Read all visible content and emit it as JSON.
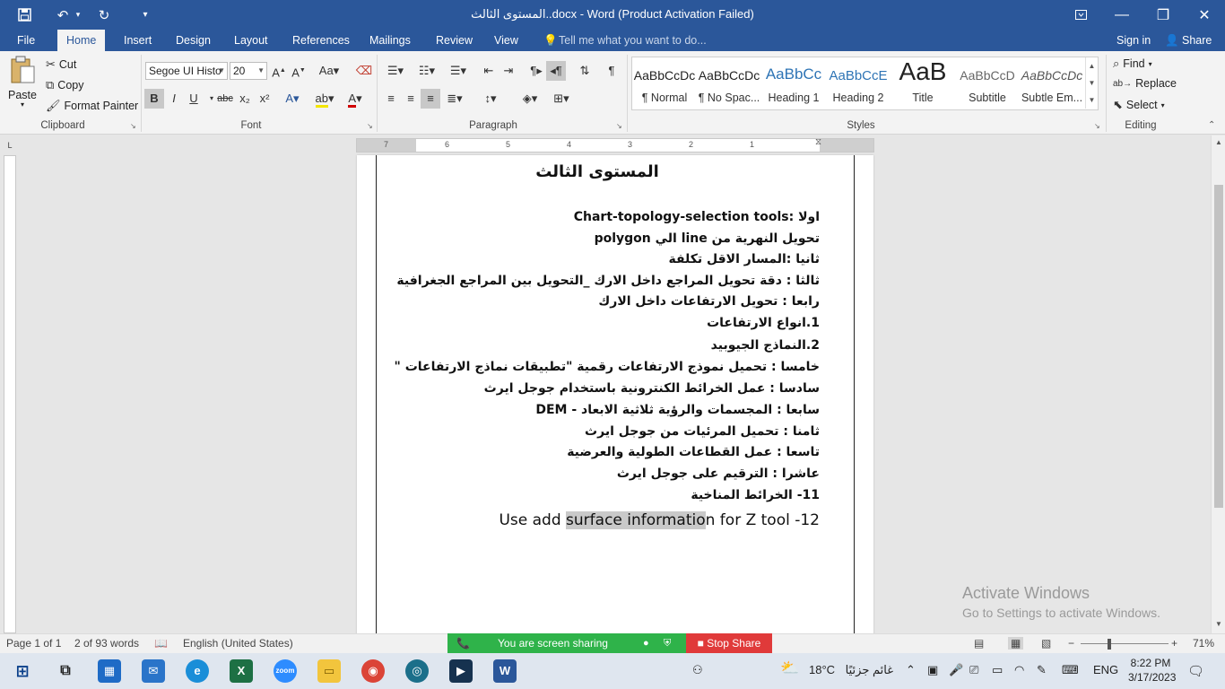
{
  "window": {
    "title": "المستوى الثالث..docx - Word (Product Activation Failed)",
    "quick_access": {
      "save": "save-icon",
      "undo": "undo-icon",
      "redo": "redo-icon",
      "customize": "▾"
    },
    "controls": {
      "ribbon_display": "ribbon-display-icon",
      "minimize": "—",
      "restore": "❐",
      "close": "✕"
    }
  },
  "tabs": [
    "File",
    "Home",
    "Insert",
    "Design",
    "Layout",
    "References",
    "Mailings",
    "Review",
    "View"
  ],
  "active_tab": "Home",
  "tell_me": "Tell me what you want to do...",
  "signin": "Sign in",
  "share": "Share",
  "clipboard": {
    "paste": "Paste",
    "cut": "Cut",
    "copy": "Copy",
    "format_painter": "Format Painter",
    "label": "Clipboard"
  },
  "font": {
    "name": "Segoe UI Histo",
    "size": "20",
    "label": "Font",
    "bold": "B",
    "italic": "I",
    "underline": "U",
    "strike": "abc",
    "subscript": "x₂",
    "superscript": "x²"
  },
  "paragraph": {
    "label": "Paragraph"
  },
  "styles": {
    "label": "Styles",
    "items": [
      {
        "preview": "AaBbCcDc",
        "label": "¶ Normal"
      },
      {
        "preview": "AaBbCcDc",
        "label": "¶ No Spac..."
      },
      {
        "preview": "AaBbCc",
        "label": "Heading 1"
      },
      {
        "preview": "AaBbCcE",
        "label": "Heading 2"
      },
      {
        "preview": "AaB",
        "label": "Title"
      },
      {
        "preview": "AaBbCcD",
        "label": "Subtitle"
      },
      {
        "preview": "AaBbCcDc",
        "label": "Subtle Em..."
      }
    ]
  },
  "editing": {
    "find": "Find",
    "replace": "Replace",
    "select": "Select",
    "label": "Editing"
  },
  "ruler": {
    "numbers": [
      "7",
      "6",
      "5",
      "4",
      "3",
      "2",
      "1"
    ]
  },
  "document": {
    "heading": "المستوى الثالث",
    "lines": [
      "اولا :Chart-topology-selection tools",
      "تحويل النهرية من  line الي  polygon",
      "ثانيا :المسار الاقل تكلفة",
      "ثالثا : دقة تحويل المراجع داخل الارك _التحويل بين المراجع الجغرافية",
      "رابعا : تحويل الارتفاعات داخل الارك",
      "1.انواع الارتفاعات",
      "2.النماذج الجيوبيد",
      "خامسا : تحميل نموذج الارتفاعات رقمية \"تطبيقات نماذج الارتفاعات \"",
      "سادسا : عمل الخرائط الكنترونية باستخدام جوجل ايرث",
      "سابعا : المجسمات والرؤية ثلاثية الابعاد - DEM",
      "ثامنا : تحميل المرئيات من جوجل ايرث",
      "تاسعا : عمل القطاعات الطولية والعرضية",
      "عاشرا : الترقيم على جوجل ايرث",
      "11- الخرائط المناخية"
    ],
    "last_line": {
      "before": "Use add ",
      "highlight": "surface informatio",
      "after": "n for Z tool -12"
    }
  },
  "watermark": {
    "line1": "Activate Windows",
    "line2": "Go to Settings to activate Windows."
  },
  "status": {
    "page": "Page 1 of 1",
    "words": "2 of 93 words",
    "language": "English (United States)",
    "zoom": "71%"
  },
  "share_bar": {
    "text": "You are screen sharing",
    "stop": "Stop Share"
  },
  "taskbar": {
    "weather_temp": "18°C",
    "weather_text": "غائم جزئيًا",
    "lang": "ENG",
    "time": "8:22 PM",
    "date": "3/17/2023",
    "zoom_app": "zoom"
  },
  "colors": {
    "accent": "#2b579a",
    "share_green": "#2fb34a",
    "stop_red": "#e03a3a"
  }
}
